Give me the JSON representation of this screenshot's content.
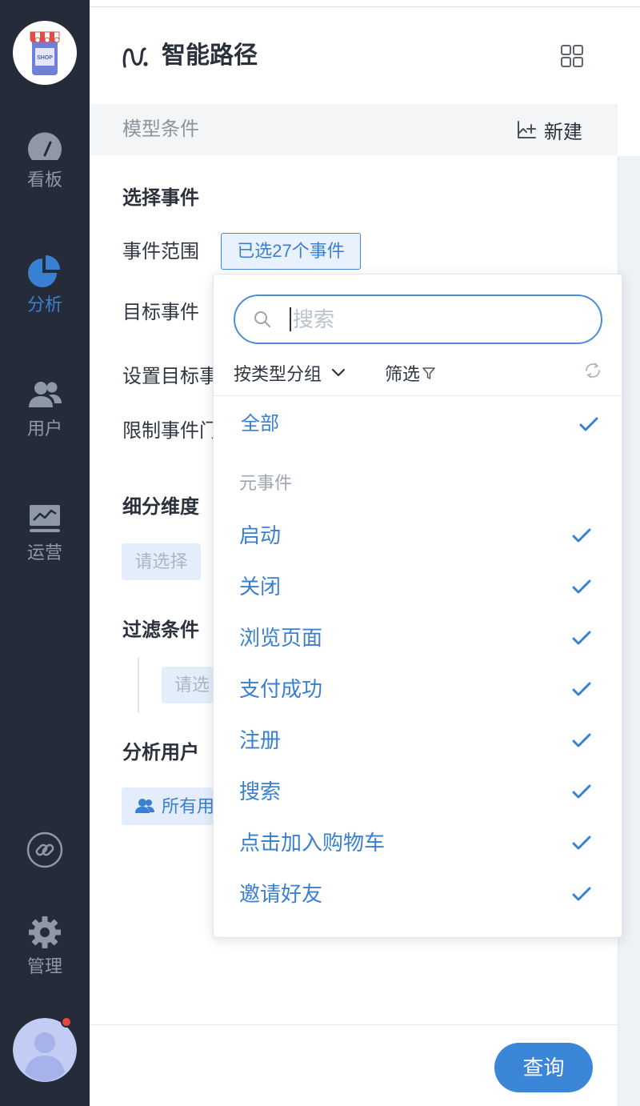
{
  "colors": {
    "accent": "#3a80d2",
    "sidebar_bg": "#252b39",
    "query_button": "#3b86d8",
    "notification_dot": "#e8463c"
  },
  "sidebar": {
    "logo_text": "SHOP",
    "active_index": 1,
    "items": [
      {
        "label": "看板",
        "icon": "gauge-icon"
      },
      {
        "label": "分析",
        "icon": "pie-chart-icon"
      },
      {
        "label": "用户",
        "icon": "users-icon"
      },
      {
        "label": "运营",
        "icon": "monitor-chart-icon"
      }
    ],
    "link_icon": "link-icon",
    "manage": {
      "label": "管理",
      "icon": "gear-icon"
    },
    "avatar": {
      "icon": "user-avatar-icon",
      "has_notification": true
    }
  },
  "header": {
    "title": "智能路径",
    "icon": "path-icon",
    "menu_icon": "grid-icon"
  },
  "model_bar": {
    "title": "模型条件",
    "new_label": "新建",
    "new_icon": "add-chart-icon"
  },
  "form": {
    "select_event_heading": "选择事件",
    "event_range_label": "事件范围",
    "event_range_value": "已选27个事件",
    "target_event_label": "目标事件",
    "set_target_label": "设置目标事",
    "limit_label": "限制事件门",
    "breakdown_heading": "细分维度",
    "breakdown_placeholder": "请选择",
    "filter_heading": "过滤条件",
    "filter_placeholder": "请选",
    "analyze_users_heading": "分析用户",
    "analyze_users_value": "所有用"
  },
  "dropdown": {
    "search_placeholder": "搜索",
    "group_by_label": "按类型分组",
    "filter_label": "筛选",
    "all": {
      "label": "全部",
      "checked": true
    },
    "group_label": "元事件",
    "items": [
      {
        "label": "启动",
        "checked": true
      },
      {
        "label": "关闭",
        "checked": true
      },
      {
        "label": "浏览页面",
        "checked": true
      },
      {
        "label": "支付成功",
        "checked": true
      },
      {
        "label": "注册",
        "checked": true
      },
      {
        "label": "搜索",
        "checked": true
      },
      {
        "label": "点击加入购物车",
        "checked": true
      },
      {
        "label": "邀请好友",
        "checked": true
      }
    ]
  },
  "footer": {
    "query_label": "查询"
  }
}
